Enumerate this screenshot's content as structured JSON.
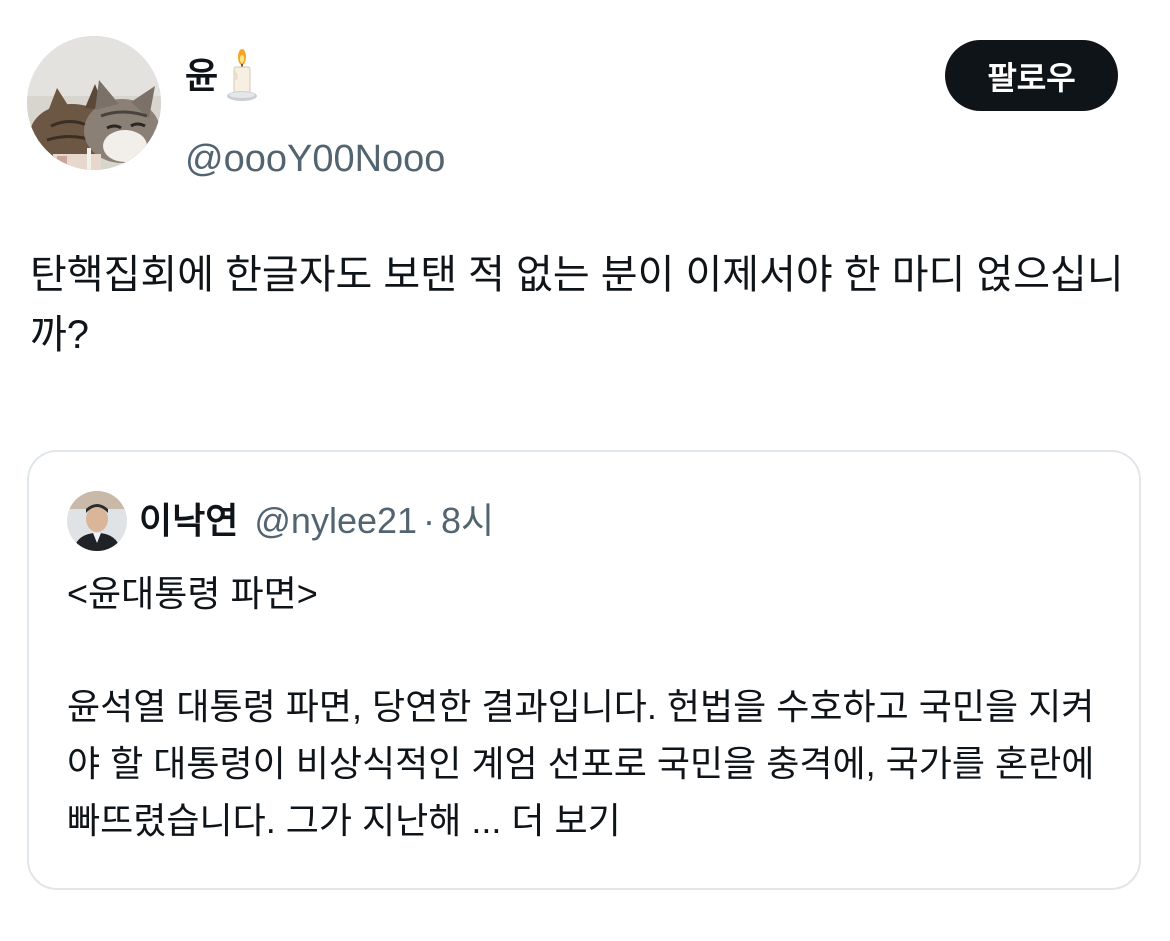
{
  "author": {
    "display_name": "윤",
    "handle": "@oooY00Nooo",
    "emoji": "candle-icon"
  },
  "follow_button": {
    "label": "팔로우"
  },
  "tweet": {
    "text": "탄핵집회에 한글자도 보탠 적 없는 분이 이제서야 한 마디 얹으십니까?"
  },
  "quote": {
    "display_name": "이낙연",
    "handle": "@nylee21",
    "separator": "·",
    "time": "8시",
    "title": "<윤대통령 파면>",
    "body": "윤석열 대통령 파면, 당연한 결과입니다. 헌법을 수호하고 국민을 지켜야 할 대통령이 비상식적인 계엄 선포로 국민을 충격에, 국가를 혼란에 빠뜨렸습니다. 그가 지난해",
    "ellipsis": " ...",
    "show_more": "더 보기"
  },
  "colors": {
    "text_primary": "#0f1419",
    "text_secondary": "#536471",
    "border": "#e1e6ea",
    "button_bg": "#0f1419",
    "button_text": "#ffffff"
  }
}
